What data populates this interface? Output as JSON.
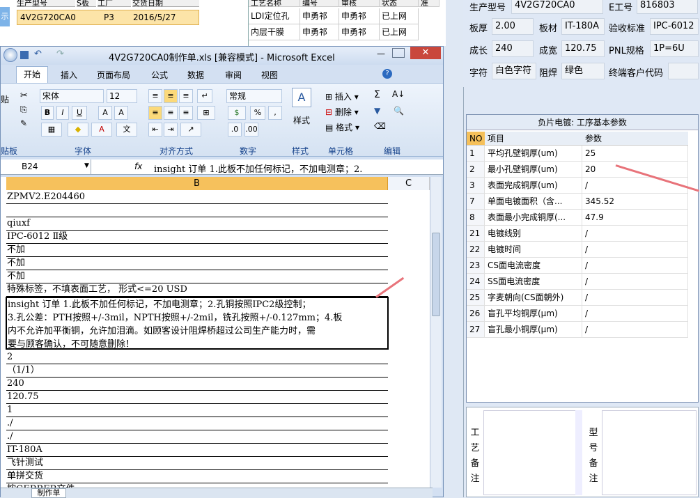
{
  "bg_list": {
    "headers": [
      "生产型号",
      "S板",
      "工厂",
      "交货日期"
    ],
    "row": {
      "model": "4V2G720CA0",
      "col3": "P3",
      "date": "2016/5/27"
    },
    "strip": "示"
  },
  "bg_process": {
    "headers": [
      "工艺名称",
      "编号",
      "审核",
      "状态",
      "准"
    ],
    "rows": [
      [
        "LDI定位孔",
        "申勇祁",
        "申勇祁",
        "已上网"
      ],
      [
        "内层干膜",
        "申勇祁",
        "申勇祁",
        "已上网"
      ]
    ]
  },
  "info": {
    "model_label": "生产型号",
    "model": "4V2G720CA0",
    "eno_label": "E工号",
    "eno": "816803",
    "thickness_label": "板厚",
    "thickness": "2.00",
    "material_label": "板材",
    "material": "IT-180A",
    "standard_label": "验收标准",
    "standard": "IPC-6012",
    "length_label": "成长",
    "length": "240",
    "width_label": "成宽",
    "width": "120.75",
    "pnl_label": "PNL规格",
    "pnl": "1P=6U",
    "char_label": "字符",
    "char": "白色字符",
    "mask_label": "阻焊",
    "mask": "绿色",
    "customer_label": "终端客户代码",
    "customer": ""
  },
  "params": {
    "title": "负片电镀: 工序基本参数",
    "headers": [
      "NO",
      "项目",
      "参数"
    ],
    "rows": [
      [
        "1",
        "平均孔壁铜厚(um)",
        "25"
      ],
      [
        "2",
        "最小孔壁铜厚(um)",
        "20"
      ],
      [
        "3",
        "表面完成铜厚(um)",
        "/"
      ],
      [
        "7",
        "单面电镀面积（含...",
        "345.52"
      ],
      [
        "8",
        "表面最小完成铜厚(...",
        "47.9"
      ],
      [
        "21",
        "电镀线别",
        "/"
      ],
      [
        "22",
        "电镀时间",
        "/"
      ],
      [
        "23",
        "CS面电流密度",
        "/"
      ],
      [
        "24",
        "SS面电流密度",
        "/"
      ],
      [
        "25",
        "字麦朝向(CS面朝外)",
        "/"
      ],
      [
        "26",
        "盲孔平均铜厚(μm)",
        "/"
      ],
      [
        "27",
        "盲孔最小铜厚(μm)",
        "/"
      ]
    ]
  },
  "notes": {
    "process_label": "工艺备注",
    "model_label": "型号备注"
  },
  "excel": {
    "title": "4V2G720CA0制作单.xls  [兼容模式] - Microsoft Excel",
    "tabs": [
      "开始",
      "插入",
      "页面布局",
      "公式",
      "数据",
      "审阅",
      "视图"
    ],
    "font_name": "宋体",
    "font_size": "12",
    "number_format": "常规",
    "groups": [
      "贴板",
      "字体",
      "对齐方式",
      "数字",
      "样式",
      "单元格",
      "编辑"
    ],
    "paste": "贴",
    "style_btn": "样式",
    "cell_buttons": [
      "插入",
      "删除",
      "格式"
    ],
    "name_box": "B24",
    "fx": "fx",
    "formula": "insight 订单 1.此板不加任何标记，不加电测章；2.",
    "col_b": "B",
    "col_c": "C",
    "cells": [
      "ZPMV2.E204460",
      "",
      "qiuxf",
      "IPC-6012 Ⅱ级",
      "不加",
      "不加",
      "不加",
      "特殊标签，不填表面工艺， 形式<=20 USD"
    ],
    "big_cell": [
      "insight 订单 1.此板不加任何标记，不加电测章；2.孔铜按照IPC2级控制；",
      "3.孔公差：PTH按照+/-3mil，NPTH按照+/-2mil，铣孔按照+/-0.127mm；4.板",
      "内不允许加平衡铜，允许加泪滴。如顾客设计阻焊桥超过公司生产能力时，需",
      "要与顾客确认，不可随意删除！"
    ],
    "cells_after": [
      "2",
      "（1/1）",
      "240",
      "120.75",
      "1",
      "./",
      "./",
      "IT-180A",
      "飞针测试",
      "单拼交货",
      "按GERBER文件"
    ],
    "sheet_tab": "制作单"
  }
}
